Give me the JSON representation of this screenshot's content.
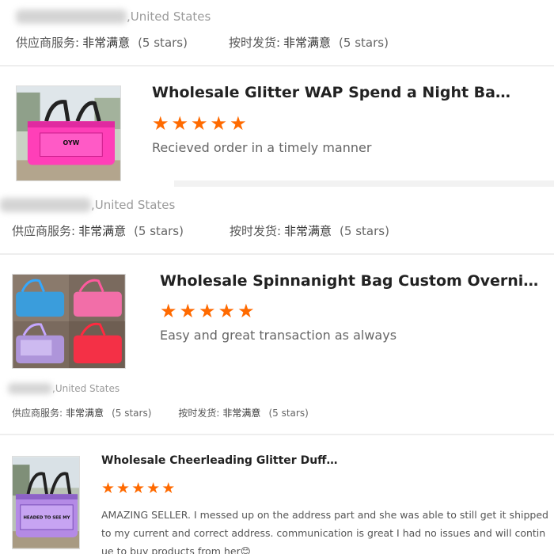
{
  "reviews": [
    {
      "country": ",United States",
      "supplier_service_label": "供应商服务:",
      "supplier_service_value": "非常满意",
      "supplier_service_stars": "(5 stars)",
      "ontime_label": "按时发货:",
      "ontime_value": "非常满意",
      "ontime_stars": "(5 stars)",
      "product_title": "Wholesale Glitter WAP Spend a Night Bag Cust...",
      "rating": 5,
      "comment": "Recieved order in a timely manner",
      "star_color": "#ff6a00"
    },
    {
      "country": ",United States",
      "supplier_service_label": "供应商服务:",
      "supplier_service_value": "非常满意",
      "supplier_service_stars": "(5 stars)",
      "ontime_label": "按时发货:",
      "ontime_value": "非常满意",
      "ontime_stars": "(5 stars)",
      "product_title": "Wholesale Spinnanight Bag Custom Overnight ...",
      "rating": 5,
      "comment": "Easy and great transaction as always",
      "star_color": "#ff6a00"
    },
    {
      "country": ",United States",
      "supplier_service_label": "供应商服务:",
      "supplier_service_value": "非常满意",
      "supplier_service_stars": "(5 stars)",
      "ontime_label": "按时发货:",
      "ontime_value": "非常满意",
      "ontime_stars": "(5 stars)",
      "product_title": "Wholesale Cheerleading Glitter Duffel Bag Cust...",
      "rating": 5,
      "comment": "AMAZING SELLER. I messed up on the address part and she was able to still get it shipped to my current and correct address. communication is great I had no issues and will continue to buy products from her",
      "comment_emoji": "😊",
      "star_color": "#ff6a00"
    }
  ],
  "thumb_text": {
    "bag1_brand": "OYW",
    "bag3_brand": "HEADED TO SEE MY"
  }
}
